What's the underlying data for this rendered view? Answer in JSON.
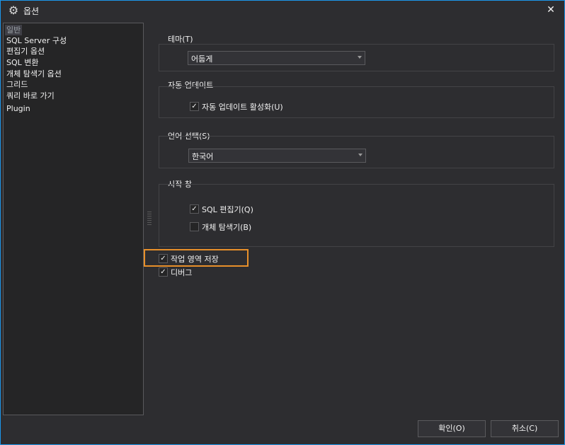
{
  "window": {
    "title": "옵션",
    "title_icon": "gear-icon",
    "close_icon": "close-icon",
    "close_label": "✕"
  },
  "tree": {
    "items": [
      {
        "label": "일반",
        "selected": true
      },
      {
        "label": "SQL Server 구성"
      },
      {
        "label": "편집기 옵션"
      },
      {
        "label": "SQL 변환"
      },
      {
        "label": "개체 탐색기 옵션"
      },
      {
        "label": "그리드"
      },
      {
        "label": "쿼리 바로 가기"
      },
      {
        "label": "Plugin"
      }
    ]
  },
  "theme": {
    "label": "테마(T)",
    "value": "어둡게"
  },
  "auto_update": {
    "label": "자동 업데이트",
    "checkbox_label": "자동 업데이트 활성화(U)",
    "checked": true
  },
  "language": {
    "label": "언어 선택(S)",
    "value": "한국어"
  },
  "startup": {
    "label": "시작 창",
    "sql_editor": {
      "label": "SQL 편집기(Q)",
      "checked": true
    },
    "object_explorer": {
      "label": "개체 탐색기(B)",
      "checked": false
    }
  },
  "save_workspace": {
    "label": "작업 영역 저장",
    "checked": true
  },
  "debug": {
    "label": "디버그",
    "checked": true
  },
  "buttons": {
    "ok": "확인(O)",
    "cancel": "취소(C)"
  },
  "colors": {
    "accent_border": "#1c97ea",
    "highlight": "#e8902a"
  }
}
